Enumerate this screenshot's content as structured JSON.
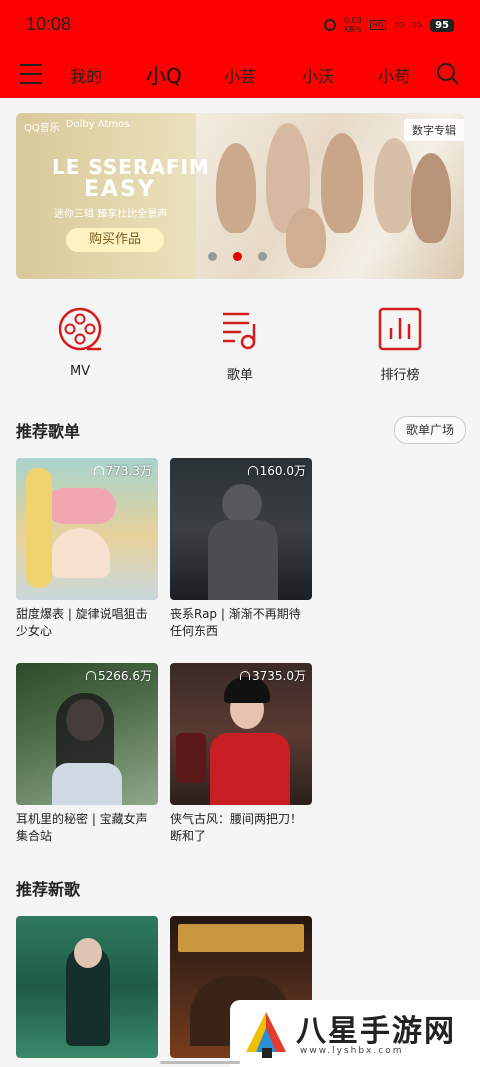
{
  "status": {
    "time": "10:08",
    "speed_top": "0.00",
    "speed_bottom": "KB/s",
    "hd": "HD",
    "sig1": "5G",
    "sig2": "5G",
    "battery": "95"
  },
  "nav": {
    "tabs": [
      "我的",
      "小Q",
      "小芸",
      "小沃",
      "小苟"
    ],
    "active_index": 1
  },
  "banner": {
    "logos": [
      "QQ音乐",
      "Dolby Atmos"
    ],
    "tag": "数字专辑",
    "title_line1": "LE SSERAFIM",
    "title_line2": "EASY",
    "subtitle": "迷你三辑 臻享杜比全景声",
    "button": "购买作品",
    "dot_count": 3,
    "active_dot": 1
  },
  "quick_actions": [
    {
      "label": "MV",
      "icon": "film-reel-icon"
    },
    {
      "label": "歌单",
      "icon": "playlist-icon"
    },
    {
      "label": "排行榜",
      "icon": "chart-icon"
    }
  ],
  "recommended_playlists": {
    "title": "推荐歌单",
    "more": "歌单广场",
    "items": [
      {
        "name": "甜度爆表 | 旋律说唱狙击少女心",
        "count": "773.3万"
      },
      {
        "name": "丧系Rap | 渐渐不再期待任何东西",
        "count": "160.0万"
      },
      {
        "name": "耳机里的秘密 | 宝藏女声集合站",
        "count": "5266.6万"
      },
      {
        "name": "侠气古风：腰间两把刀！断和了",
        "count": "3735.0万"
      }
    ]
  },
  "recommended_songs": {
    "title": "推荐新歌"
  },
  "watermark": {
    "text": "八星手游网",
    "url": "www.lyshbx.com"
  },
  "colors": {
    "accent": "#ff0000",
    "icon_red": "#d41a1a"
  }
}
